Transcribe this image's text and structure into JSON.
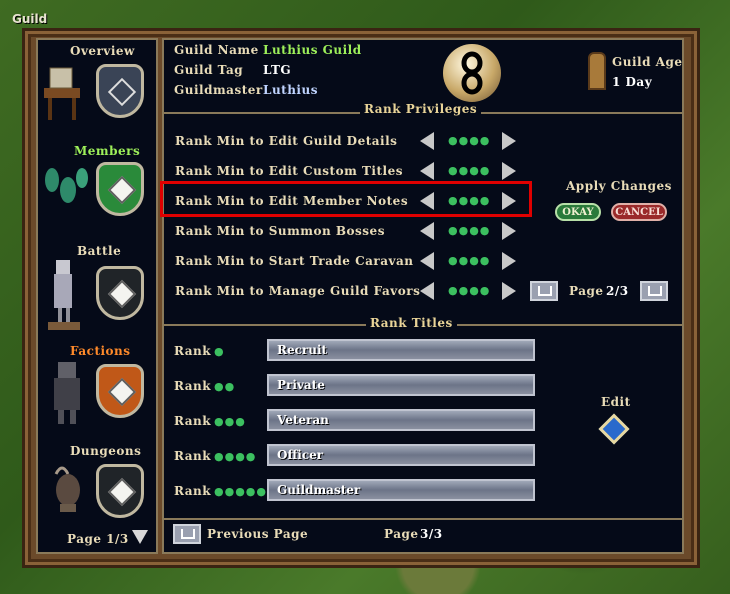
{
  "window": {
    "title": "Guild"
  },
  "sidebar": {
    "items": [
      {
        "label": "Overview"
      },
      {
        "label": "Members"
      },
      {
        "label": "Battle"
      },
      {
        "label": "Factions"
      },
      {
        "label": "Dungeons"
      }
    ],
    "page": "Page 1/3"
  },
  "guild": {
    "name_label": "Guild Name",
    "name_value": "Luthius Guild",
    "tag_label": "Guild Tag",
    "tag_value": "LTG",
    "master_label": "Guildmaster",
    "master_value": "Luthius",
    "age_label": "Guild Age",
    "age_value": "1 Day"
  },
  "privileges": {
    "header": "Rank Privileges",
    "rows": [
      {
        "label": "Rank Min to Edit Guild Details",
        "dots": "●●●●"
      },
      {
        "label": "Rank Min to Edit Custom Titles",
        "dots": "●●●●"
      },
      {
        "label": "Rank Min to Edit Member Notes",
        "dots": "●●●●"
      },
      {
        "label": "Rank Min to Summon Bosses",
        "dots": "●●●●"
      },
      {
        "label": "Rank Min to Start Trade Caravan",
        "dots": "●●●●"
      },
      {
        "label": "Rank Min to Manage Guild Favors",
        "dots": "●●●●"
      }
    ],
    "apply_label": "Apply Changes",
    "okay": "OKAY",
    "cancel": "CANCEL",
    "page_label": "Page",
    "page_value": "2/3"
  },
  "titles": {
    "header": "Rank Titles",
    "rows": [
      {
        "label": "Rank",
        "dots": "●",
        "title": "Recruit"
      },
      {
        "label": "Rank",
        "dots": "●●",
        "title": "Private"
      },
      {
        "label": "Rank",
        "dots": "●●●",
        "title": "Veteran"
      },
      {
        "label": "Rank",
        "dots": "●●●●",
        "title": "Officer"
      },
      {
        "label": "Rank",
        "dots": "●●●●●",
        "title": "Guildmaster"
      }
    ],
    "edit_label": "Edit"
  },
  "footer": {
    "prev_label": "Previous Page",
    "page_label": "Page",
    "page_value": "3/3"
  },
  "colors": {
    "highlight": "#e00000",
    "dot_green": "#3cc060"
  }
}
